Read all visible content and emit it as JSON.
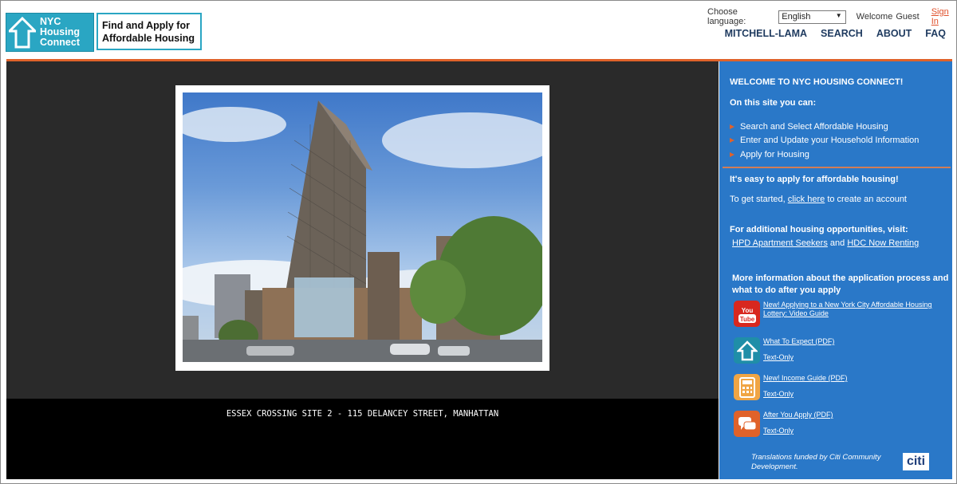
{
  "header": {
    "logo_line1": "NYC",
    "logo_line2": "Housing",
    "logo_line3": "Connect",
    "tagline_line1": "Find and Apply for",
    "tagline_line2": "Affordable Housing",
    "choose_language_label": "Choose language:",
    "language_value": "English",
    "welcome_label": "Welcome",
    "user_name": "Guest",
    "sign_in": "Sign In",
    "nav": [
      "MITCHELL-LAMA",
      "SEARCH",
      "ABOUT",
      "FAQ"
    ]
  },
  "main": {
    "caption": "ESSEX CROSSING SITE 2 - 115 DELANCEY STREET, MANHATTAN"
  },
  "sidebar": {
    "welcome_title": "WELCOME TO NYC HOUSING CONNECT!",
    "intro": "On this site you can:",
    "can_items": [
      "Search and Select Affordable Housing",
      "Enter and Update your Household Information",
      "Apply for Housing"
    ],
    "easy_title": "It's easy to apply for affordable housing!",
    "get_started_prefix": "To get started,",
    "click_here": "click here",
    "get_started_suffix": "to create an account",
    "additional_title": "For additional housing opportunities, visit:",
    "hpd_link": "HPD Apartment Seekers",
    "and_word": "and",
    "hdc_link": "HDC Now Renting",
    "more_info_line1": "More information about the application process and",
    "more_info_line2": "what to do after you apply",
    "resources": [
      {
        "icon": "youtube-icon",
        "line1": "New! Applying to a New York City Affordable Housing",
        "line2": "Lottery: Video Guide",
        "color": "#d8281f"
      },
      {
        "icon": "house-icon",
        "line1": "What To Expect (PDF)",
        "line2": "Text-Only",
        "color": "#1f8ea8"
      },
      {
        "icon": "calculator-icon",
        "line1": "New! Income Guide (PDF)",
        "line2": "Text-Only",
        "color": "#f0a544"
      },
      {
        "icon": "chat-icon",
        "line1": "After You Apply (PDF)",
        "line2": "Text-Only",
        "color": "#e0622a"
      }
    ],
    "credit": "Translations funded by Citi Community Development.",
    "citi_logo": "citi"
  },
  "colors": {
    "brand_teal": "#2aa6c3",
    "accent_orange": "#e0622a",
    "sidebar_blue": "#2a78c8",
    "nav_text": "#1e3a5f"
  }
}
